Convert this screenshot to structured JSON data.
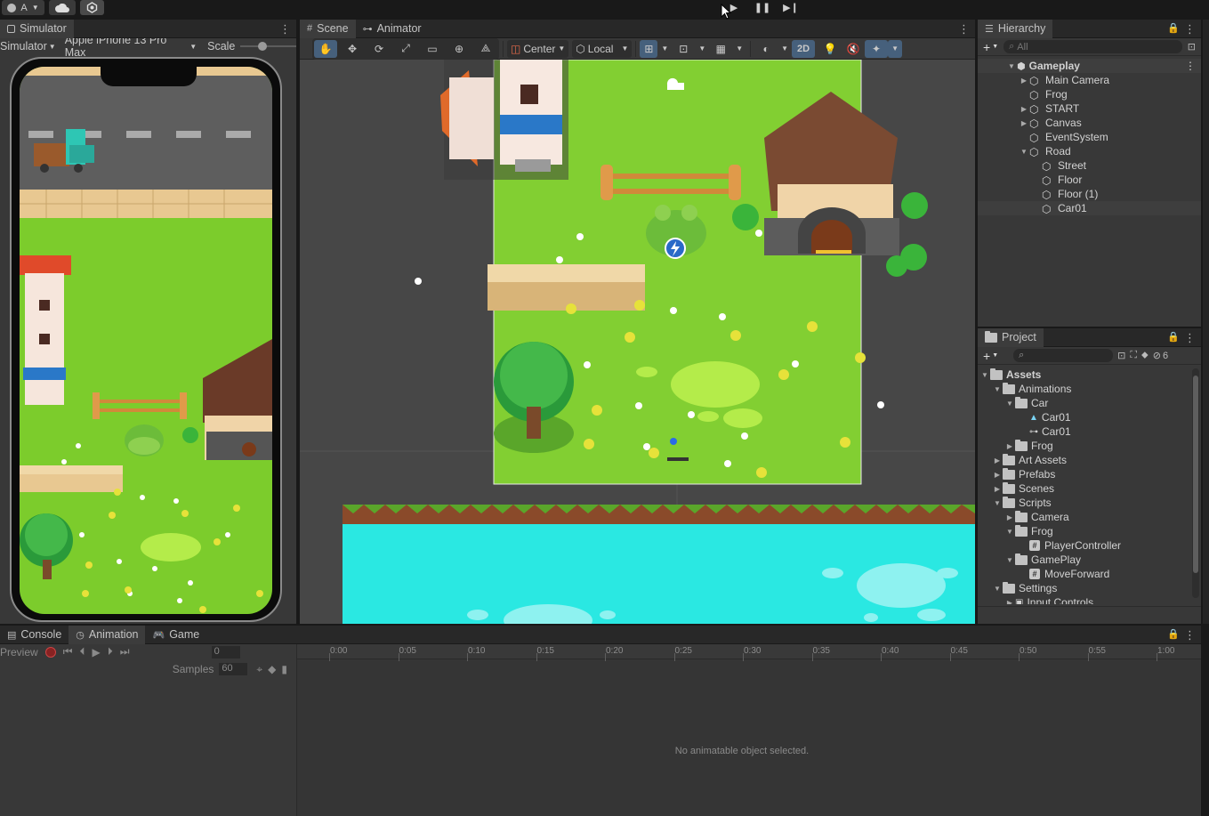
{
  "topbar": {
    "account_label": "A"
  },
  "simulator": {
    "tab_label": "Simulator",
    "mode_label": "Simulator",
    "device_label": "Apple iPhone 13 Pro Max",
    "scale_label": "Scale"
  },
  "scene": {
    "tabs": [
      {
        "label": "Scene"
      },
      {
        "label": "Animator"
      }
    ],
    "pivot_label": "Center",
    "space_label": "Local",
    "mode_2d_label": "2D"
  },
  "hierarchy": {
    "tab_label": "Hierarchy",
    "search_placeholder": "All",
    "items": [
      {
        "label": "Gameplay"
      },
      {
        "label": "Main Camera"
      },
      {
        "label": "Frog"
      },
      {
        "label": "START"
      },
      {
        "label": "Canvas"
      },
      {
        "label": "EventSystem"
      },
      {
        "label": "Road"
      },
      {
        "label": "Street"
      },
      {
        "label": "Floor"
      },
      {
        "label": "Floor (1)"
      },
      {
        "label": "Car01"
      }
    ]
  },
  "project": {
    "tab_label": "Project",
    "hidden_count": "6",
    "items": [
      {
        "label": "Assets"
      },
      {
        "label": "Animations"
      },
      {
        "label": "Car"
      },
      {
        "label": "Car01"
      },
      {
        "label": "Car01"
      },
      {
        "label": "Frog"
      },
      {
        "label": "Art Assets"
      },
      {
        "label": "Prefabs"
      },
      {
        "label": "Scenes"
      },
      {
        "label": "Scripts"
      },
      {
        "label": "Camera"
      },
      {
        "label": "Frog"
      },
      {
        "label": "PlayerController"
      },
      {
        "label": "GamePlay"
      },
      {
        "label": "MoveForward"
      },
      {
        "label": "Settings"
      },
      {
        "label": "Input Controls"
      }
    ]
  },
  "bottom": {
    "tabs": [
      {
        "label": "Console"
      },
      {
        "label": "Animation"
      },
      {
        "label": "Game"
      }
    ],
    "preview_label": "Preview",
    "frame_value": "0",
    "samples_label": "Samples",
    "samples_value": "60",
    "ruler": [
      "0:00",
      "0:05",
      "0:10",
      "0:15",
      "0:20",
      "0:25",
      "0:30",
      "0:35",
      "0:40",
      "0:45",
      "0:50",
      "0:55",
      "1:00"
    ],
    "empty_message": "No animatable object selected."
  }
}
